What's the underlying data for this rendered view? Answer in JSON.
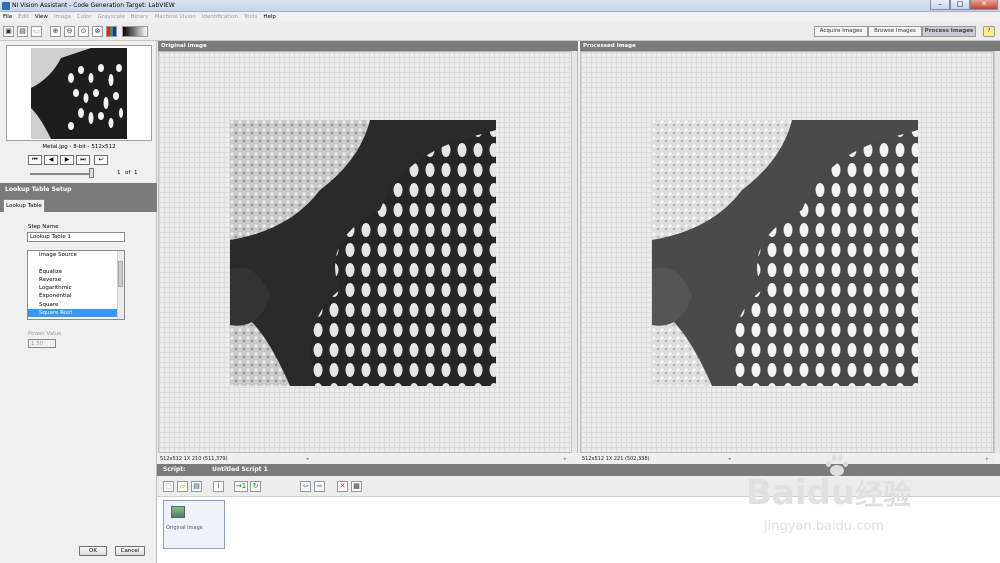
{
  "window": {
    "title": "NI Vision Assistant - Code Generation Target: LabVIEW"
  },
  "menu": {
    "items": [
      {
        "label": "File",
        "enabled": true
      },
      {
        "label": "Edit",
        "enabled": false
      },
      {
        "label": "View",
        "enabled": true
      },
      {
        "label": "Image",
        "enabled": false
      },
      {
        "label": "Color",
        "enabled": false
      },
      {
        "label": "Grayscale",
        "enabled": false
      },
      {
        "label": "Binary",
        "enabled": false
      },
      {
        "label": "Machine Vision",
        "enabled": false
      },
      {
        "label": "Identification",
        "enabled": false
      },
      {
        "label": "Tools",
        "enabled": false
      },
      {
        "label": "Help",
        "enabled": true
      }
    ]
  },
  "modes": {
    "acquire": "Acquire Images",
    "browse": "Browse Images",
    "process": "Process Images",
    "help_icon": "?"
  },
  "browser": {
    "image_caption": "Metal.jpg - 8-bit - 512x512",
    "index": "1",
    "of_label": "of",
    "total": "1"
  },
  "setup": {
    "title": "Lookup Table Setup",
    "tab": "Lookup Table",
    "step_name_label": "Step Name",
    "step_name_value": "Lookup Table 1",
    "functions": [
      "Image Source",
      "",
      "Equalize",
      "Reverse",
      "Logarithmic",
      "Exponential",
      "Square",
      "Square Root"
    ],
    "selected_function": "Square Root",
    "power_label": "Power Value",
    "power_value": "1.50",
    "ok": "OK",
    "cancel": "Cancel"
  },
  "original": {
    "title": "Original Image",
    "status": "512x512 1X 210    (511,379)"
  },
  "processed": {
    "title": "Processed Image",
    "status": "512x512 1X 221    (502,338)"
  },
  "script": {
    "label": "Script:",
    "name": "Untitled Script 1",
    "step_label": "Original Image"
  },
  "watermark": {
    "brand": "Bai",
    "brand2": "du",
    "cn": "经验",
    "url": "jingyan.baidu.com"
  },
  "colors": {
    "header_gray": "#7b7b7b",
    "selection": "#3399ff",
    "watermark": "#cfcfcf"
  }
}
